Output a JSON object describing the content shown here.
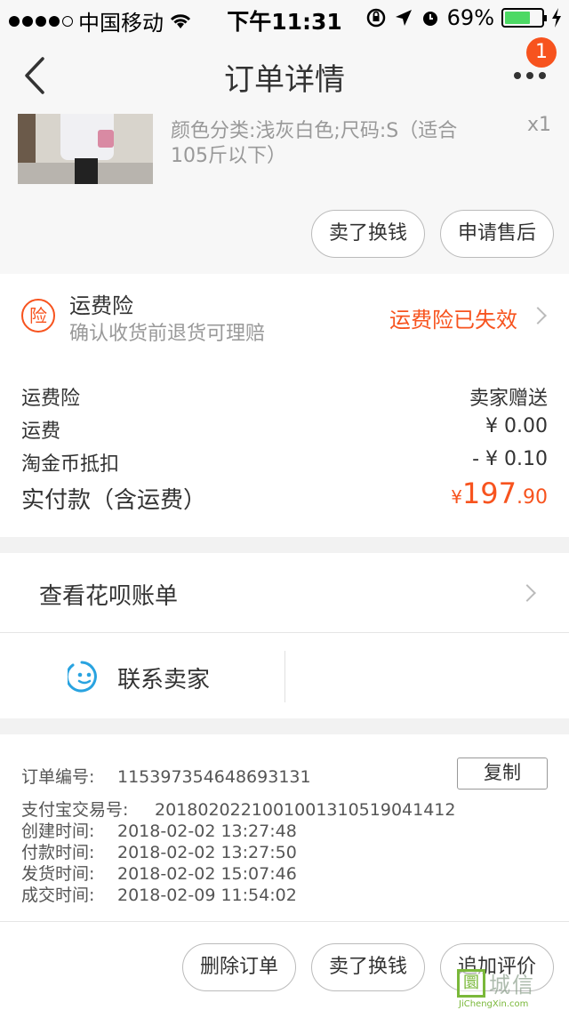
{
  "status_bar": {
    "carrier": "中国移动",
    "time": "下午11:31",
    "battery": "69%",
    "battery_level": 0.69,
    "battery_color": "#4cd964"
  },
  "nav": {
    "title": "订单详情",
    "badge": "1",
    "back_icon": "chevron-left-icon",
    "more_icon": "ellipsis-icon"
  },
  "product": {
    "spec": "颜色分类:浅灰白色;尺码:S（适合105斤以下）",
    "qty": "x1",
    "buttons": [
      "卖了换钱",
      "申请售后"
    ]
  },
  "insurance": {
    "icon_text": "险",
    "title": "运费险",
    "subtitle": "确认收货前退货可理赔",
    "status": "运费险已失效"
  },
  "fees": {
    "rows": [
      {
        "label": "运费险",
        "value": "卖家赠送"
      },
      {
        "label": "运费",
        "value": "¥ 0.00"
      },
      {
        "label": "淘金币抵扣",
        "value": "- ¥ 0.10"
      }
    ],
    "paid_label": "实付款（含运费）",
    "paid_currency": "¥",
    "paid_int": "197",
    "paid_dec": ".90"
  },
  "huabei": {
    "label": "查看花呗账单"
  },
  "contact": {
    "label": "联系卖家",
    "icon": "chat-face-icon"
  },
  "order_info": {
    "copy_label": "复制",
    "rows": [
      {
        "label": "订单编号:",
        "value": "115397354648693131"
      },
      {
        "label": "支付宝交易号:",
        "value": "2018020221001001310519041412"
      },
      {
        "label": "创建时间:",
        "value": "2018-02-02 13:27:48"
      },
      {
        "label": "付款时间:",
        "value": "2018-02-02 13:27:50"
      },
      {
        "label": "发货时间:",
        "value": "2018-02-02 15:07:46"
      },
      {
        "label": "成交时间:",
        "value": "2018-02-09 11:54:02"
      }
    ]
  },
  "bottom_actions": [
    "删除订单",
    "卖了换钱",
    "追加评价"
  ],
  "watermark": {
    "box": "圜",
    "cn": "城信",
    "en": "JiChengXin.com"
  },
  "colors": {
    "accent": "#f7531e",
    "contact_icon": "#29a3e0"
  }
}
